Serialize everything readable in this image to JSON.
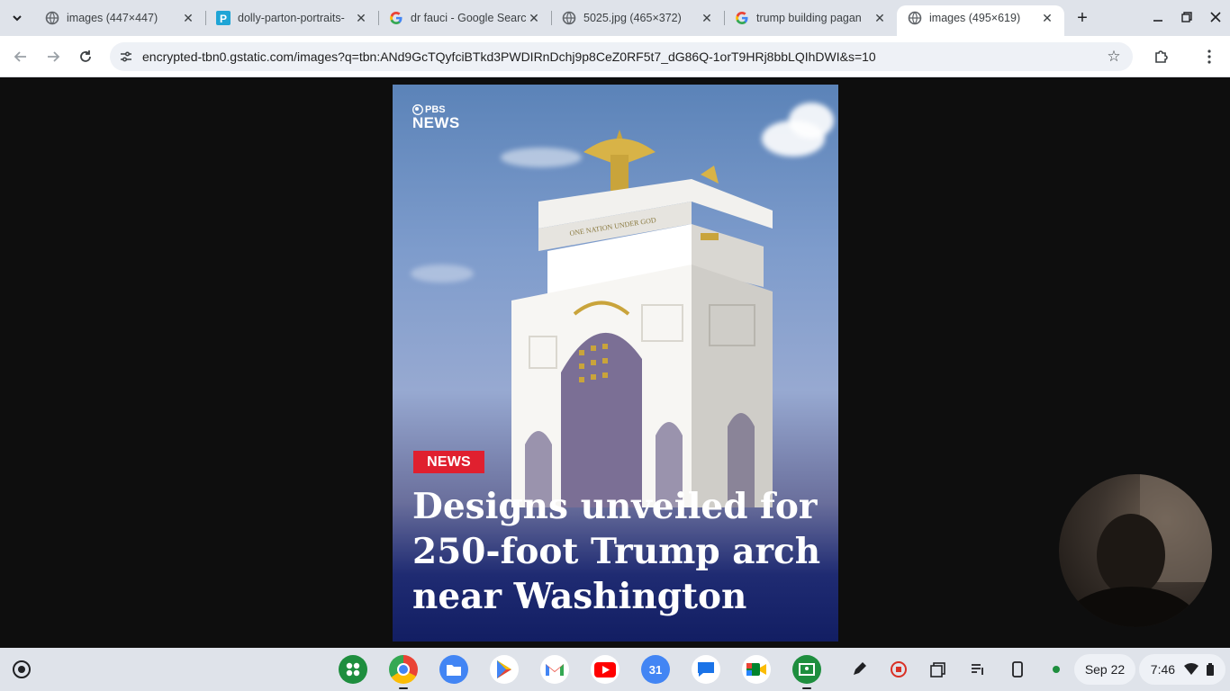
{
  "tabs": [
    {
      "title": "images (447×447)",
      "favicon": "globe-icon",
      "active": false
    },
    {
      "title": "dolly-parton-portraits-",
      "favicon": "p-icon",
      "active": false
    },
    {
      "title": "dr fauci - Google Search",
      "favicon": "google-icon",
      "active": false
    },
    {
      "title": "5025.jpg (465×372)",
      "favicon": "globe-icon",
      "active": false
    },
    {
      "title": "trump building pagan",
      "favicon": "google-icon",
      "active": false
    },
    {
      "title": "images (495×619)",
      "favicon": "globe-icon",
      "active": true
    }
  ],
  "address_bar": {
    "url": "encrypted-tbn0.gstatic.com/images?q=tbn:ANd9GcTQyfciBTkd3PWDIRnDchj9p8CeZ0RF5t7_dG86Q-1orT9HRj8bbLQIhDWI&s=10"
  },
  "image": {
    "logo_line1": "PBS",
    "logo_line2": "NEWS",
    "badge": "NEWS",
    "headline_lines": [
      "Designs unveiled for",
      "250-foot Trump arch",
      "near Washington"
    ],
    "arch_inscription": "ONE NATION UNDER GOD",
    "colors": {
      "badge": "#e0202f",
      "caption_bg": "#121e63"
    }
  },
  "shelf": {
    "apps": [
      "app-launcher-icon",
      "chrome-icon",
      "files-icon",
      "play-store-icon",
      "gmail-icon",
      "youtube-icon",
      "calendar-icon",
      "messages-icon",
      "meet-icon",
      "classroom-icon"
    ],
    "calendar_day": "31",
    "date": "Sep 22",
    "time": "7:46"
  }
}
